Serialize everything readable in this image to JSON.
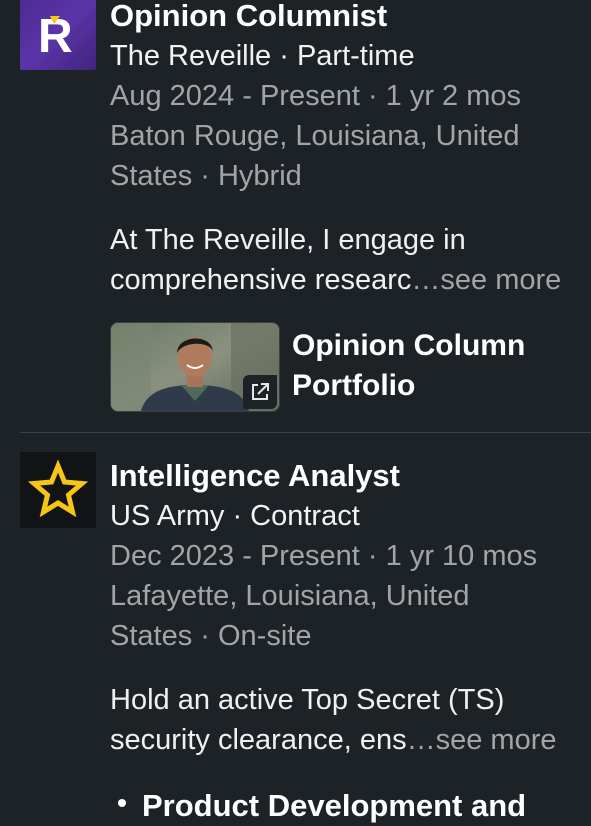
{
  "experiences": [
    {
      "logo_letter": "R",
      "title": "Opinion Columnist",
      "company_line": "The Reveille · Part-time",
      "dates": "Aug 2024 - Present · 1 yr 2 mos",
      "location_line1": "Baton Rouge, Louisiana, United",
      "location_line2": "States · Hybrid",
      "desc_line1": "At The Reveille, I engage in",
      "desc_line2": "comprehensive researc",
      "see_more": "…see more",
      "media": {
        "title_line1": "Opinion Column",
        "title_line2": "Portfolio"
      }
    },
    {
      "title": "Intelligence Analyst",
      "company_line": "US Army · Contract",
      "dates": "Dec 2023 - Present · 1 yr 10 mos",
      "location_line1": "Lafayette, Louisiana, United",
      "location_line2": "States · On-site",
      "desc_line1": "Hold an active Top Secret (TS)",
      "desc_line2": "security clearance, ens",
      "see_more": "…see more"
    }
  ],
  "next_entry_title": "Product Development and",
  "colors": {
    "background": "#1d2226",
    "muted_text": "#a2a5a8",
    "army_star": "#f5c518",
    "reveille_purple": "#4b2a8f"
  },
  "icons": [
    "reveille-logo-icon",
    "army-star-icon",
    "external-link-icon"
  ]
}
